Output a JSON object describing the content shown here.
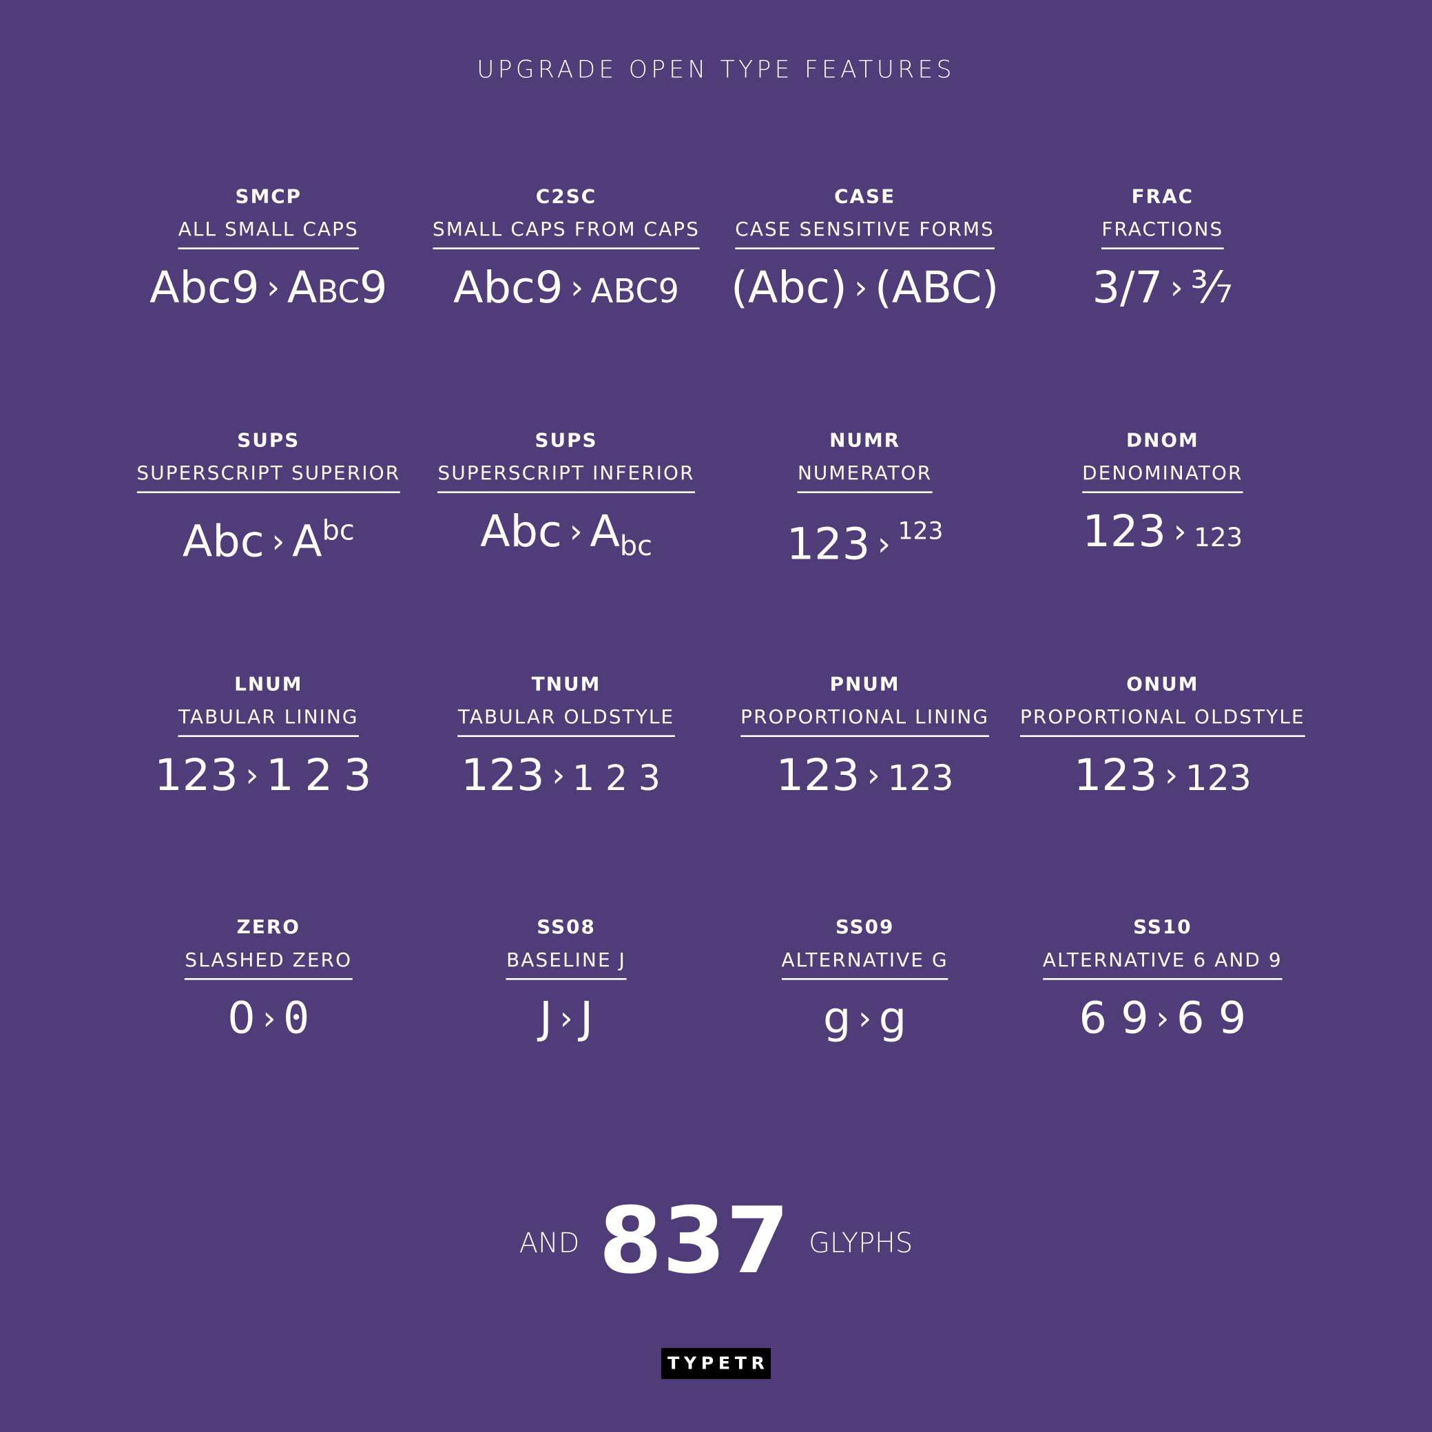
{
  "title": "UPGRADE OPEN TYPE FEATURES",
  "separator": "›",
  "features": [
    {
      "code": "SMCP",
      "name": "ALL SMALL CAPS",
      "from": "Abc9",
      "to": "Abc9",
      "mod": "smcp"
    },
    {
      "code": "C2SC",
      "name": "SMALL CAPS FROM CAPS",
      "from": "Abc9",
      "to": "ABC9",
      "mod": "small"
    },
    {
      "code": "CASE",
      "name": "CASE SENSITIVE FORMS",
      "from": "(Abc)",
      "to": "(ABC)",
      "mod": ""
    },
    {
      "code": "FRAC",
      "name": "FRACTIONS",
      "from": "3/7",
      "to": "³⁄₇",
      "mod": "frac"
    },
    {
      "code": "SUPS",
      "name": "SUPERSCRIPT SUPERIOR",
      "from": "Abc",
      "to_base": "A",
      "to": "bc",
      "mod": "sup"
    },
    {
      "code": "SUPS",
      "name": "SUPERSCRIPT INFERIOR",
      "from": "Abc",
      "to_base": "A",
      "to": "bc",
      "mod": "sub"
    },
    {
      "code": "NUMR",
      "name": "NUMERATOR",
      "from": "123",
      "to": "123",
      "mod": "numr"
    },
    {
      "code": "DNOM",
      "name": "DENOMINATOR",
      "from": "123",
      "to": "123",
      "mod": "dnom"
    },
    {
      "code": "LNUM",
      "name": "TABULAR LINING",
      "from": "123",
      "to": "123",
      "mod": "tab"
    },
    {
      "code": "TNUM",
      "name": "TABULAR OLDSTYLE",
      "from": "123",
      "to": "123",
      "mod": "oldtab"
    },
    {
      "code": "PNUM",
      "name": "PROPORTIONAL LINING",
      "from": "123",
      "to": "123",
      "mod": "old"
    },
    {
      "code": "ONUM",
      "name": "PROPORTIONAL OLDSTYLE",
      "from": "123",
      "to": "123",
      "mod": "old"
    },
    {
      "code": "ZERO",
      "name": "SLASHED ZERO",
      "from": "0",
      "to": "0",
      "mod": "mono"
    },
    {
      "code": "SS08",
      "name": "BASELINE J",
      "from": "J",
      "to": "J",
      "mod": ""
    },
    {
      "code": "SS09",
      "name": "ALTERNATIVE G",
      "from": "g",
      "to": "g",
      "mod": ""
    },
    {
      "code": "SS10",
      "name": "ALTERNATIVE 6 AND 9",
      "from": "6 9",
      "to": "6 9",
      "mod": ""
    }
  ],
  "footer": {
    "prefix": "AND",
    "count": "837",
    "suffix": "GLYPHS"
  },
  "logo": "TYPETR",
  "colors": {
    "background": "#4f3c78",
    "text": "#ffffff",
    "logo_bg": "#000000"
  }
}
